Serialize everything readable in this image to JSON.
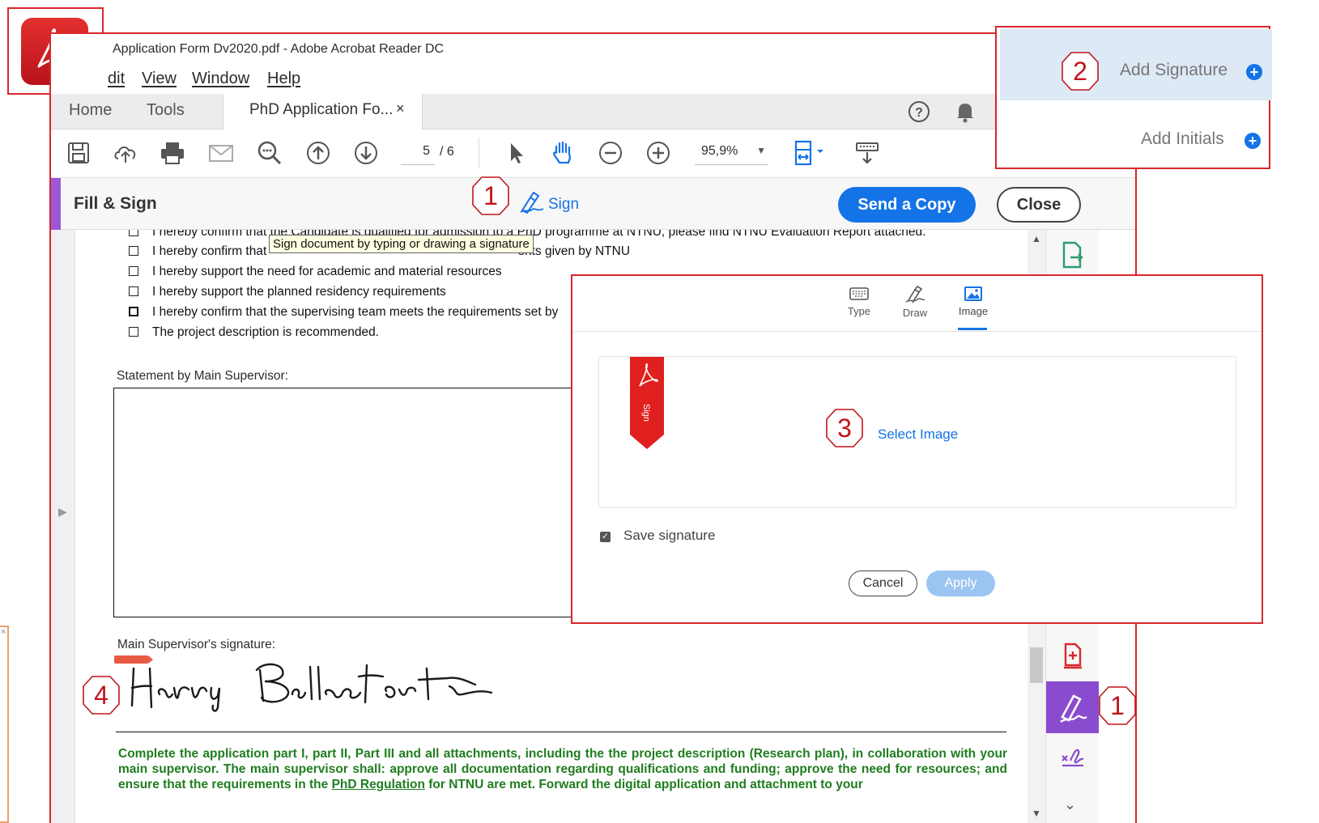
{
  "window": {
    "title": "Application Form Dv2020.pdf - Adobe Acrobat Reader DC",
    "minimize_label": "—"
  },
  "menu": {
    "items": [
      "Edit",
      "View",
      "Window",
      "Help"
    ],
    "partial_first": "dit"
  },
  "tabs": {
    "home": "Home",
    "tools": "Tools",
    "document": "PhD Application Fo...",
    "close_glyph": "×"
  },
  "toolbar": {
    "page_current": "5",
    "page_total": "/ 6",
    "zoom": "95,9%"
  },
  "fill_sign": {
    "title": "Fill & Sign",
    "sign_label": "Sign",
    "send_copy": "Send a Copy",
    "close": "Close",
    "accent_color": "#9b59d6"
  },
  "tooltip": "Sign document by typing or drawing a signature",
  "document": {
    "checkbox_rows": [
      {
        "text": "I hereby confirm that the Candidate is qualified for admission to a PhD programme at NTNU, please find NTNU Evaluation Report attached."
      },
      {
        "text": "I hereby confirm that                                                                        ents given by NTNU"
      },
      {
        "text": "I hereby support the need for academic and material resources"
      },
      {
        "text": "I hereby support the planned residency requirements"
      },
      {
        "text": "I hereby confirm that the supervising team meets the requirements set by"
      },
      {
        "text": "The project description is recommended."
      }
    ],
    "statement_label": "Statement by Main Supervisor:",
    "signature_label": "Main Supervisor's signature:",
    "signature_text": "Harry Bellafonte",
    "instruction_before_link": "Complete the application part I, part II, Part III and all attachments, including the the project description (Research plan), in collaboration with your main supervisor. The main supervisor shall: approve all documentation regarding qualifications and funding; approve the need for resources; and ensure that the requirements in the ",
    "instruction_link": "PhD Regulation",
    "instruction_after_link": " for NTNU are met. Forward the digital application and attachment to your"
  },
  "signature_panel": {
    "tabs": [
      "Type",
      "Draw",
      "Image"
    ],
    "active_tab": "Image",
    "select_image": "Select Image",
    "save_signature": "Save signature",
    "save_checked": true,
    "cancel": "Cancel",
    "apply": "Apply",
    "bookmark_label": "Sign"
  },
  "popover": {
    "add_signature": "Add Signature",
    "add_initials": "Add Initials"
  },
  "steps": {
    "s1": "1",
    "s2": "2",
    "s3": "3",
    "s4": "4"
  },
  "side_fragment_glyph": "×",
  "colors": {
    "adobe_red": "#d9262c",
    "accent_blue": "#1473e6",
    "marker_red": "#c0151b",
    "instruction_green": "#1f7d1f"
  }
}
